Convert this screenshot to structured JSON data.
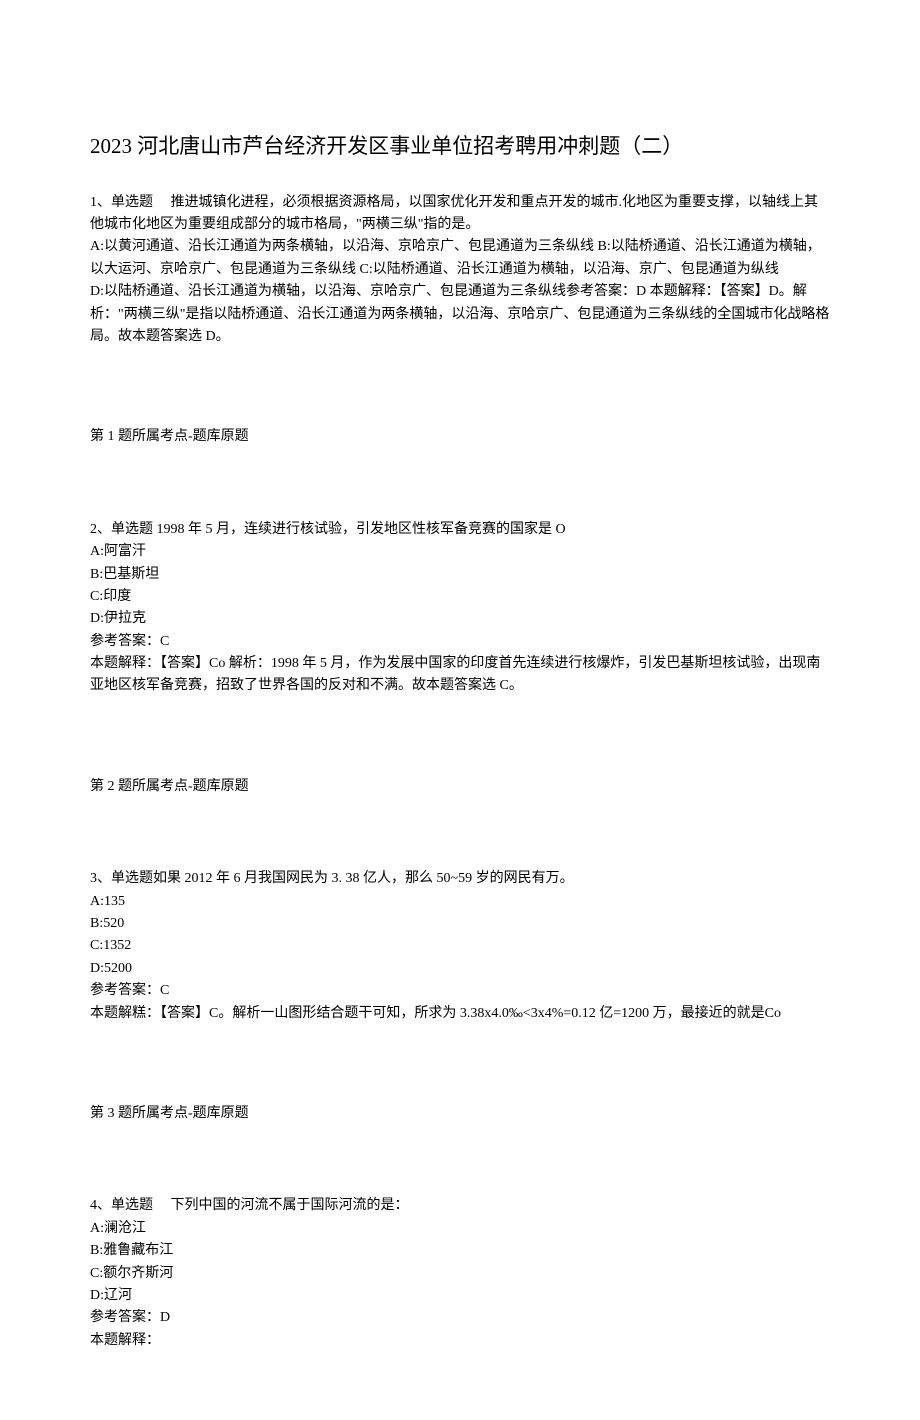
{
  "title": "2023 河北唐山市芦台经济开发区事业单位招考聘用冲刺题（二）",
  "q1": {
    "header": "1、单选题  推进城镇化进程，必须根据资源格局，以国家优化开发和重点开发的城市.化地区为重要支撑，以轴线上其他城市化地区为重要组成部分的城市格局，\"两横三纵\"指的是。",
    "A": "A:以黄河通道、沿长江通道为两条横轴，以沿海、京哈京广、包昆通道为三条纵线 B:以陆桥通道、沿长江通道为横轴，以大运河、京哈京广、包昆通道为三条纵线 C:以陆桥通道、沿长江通道为横轴，以沿海、京广、包昆通道为纵线",
    "D": "D:以陆桥通道、沿长江通道为横轴，以沿海、京哈京广、包昆通道为三条纵线参考答案：D 本题解释：【答案】D。解析：\"两横三纵\"是指以陆桥通道、沿长江通道为两条横轴，以沿海、京哈京广、包昆通道为三条纵线的全国城市化战略格局。故本题答案选 D。",
    "source": "第 1 题所属考点-题库原题"
  },
  "q2": {
    "header": "2、单选题 1998 年 5 月，连续进行核试验，引发地区性核军备竞赛的国家是 O",
    "A": "A:阿富汗",
    "B": "B:巴基斯坦",
    "C": "C:印度",
    "D": "D:伊拉克",
    "ans": "参考答案：C",
    "expl": "本题解释：【答案】Co 解析：1998 年 5 月，作为发展中国家的印度首先连续进行核爆炸，引发巴基斯坦核试验，出现南亚地区核军备竞赛，招致了世界各国的反对和不满。故本题答案选 C。",
    "source": "第 2 题所属考点-题库原题"
  },
  "q3": {
    "header": "3、单选题如果 2012 年 6 月我国网民为 3. 38 亿人，那么 50~59 岁的网民有万。",
    "A": "A:135",
    "B": "B:520",
    "C": "C:1352",
    "D": "D:5200",
    "ans": "参考答案：C",
    "expl": "本题解糕：【答案】C。解析一山图形结合题干可知，所求为 3.38x4.0‰<3x4%=0.12 亿=1200 万，最接近的就是Co",
    "source": "第 3 题所属考点-题库原题"
  },
  "q4": {
    "header": "4、单选题  下列中国的河流不属于国际河流的是：",
    "A": "A:澜沧江",
    "B": "B:雅鲁藏布江",
    "C": "C:额尔齐斯河",
    "D": "D:辽河",
    "ans": "参考答案：D",
    "expl": "本题解释："
  }
}
